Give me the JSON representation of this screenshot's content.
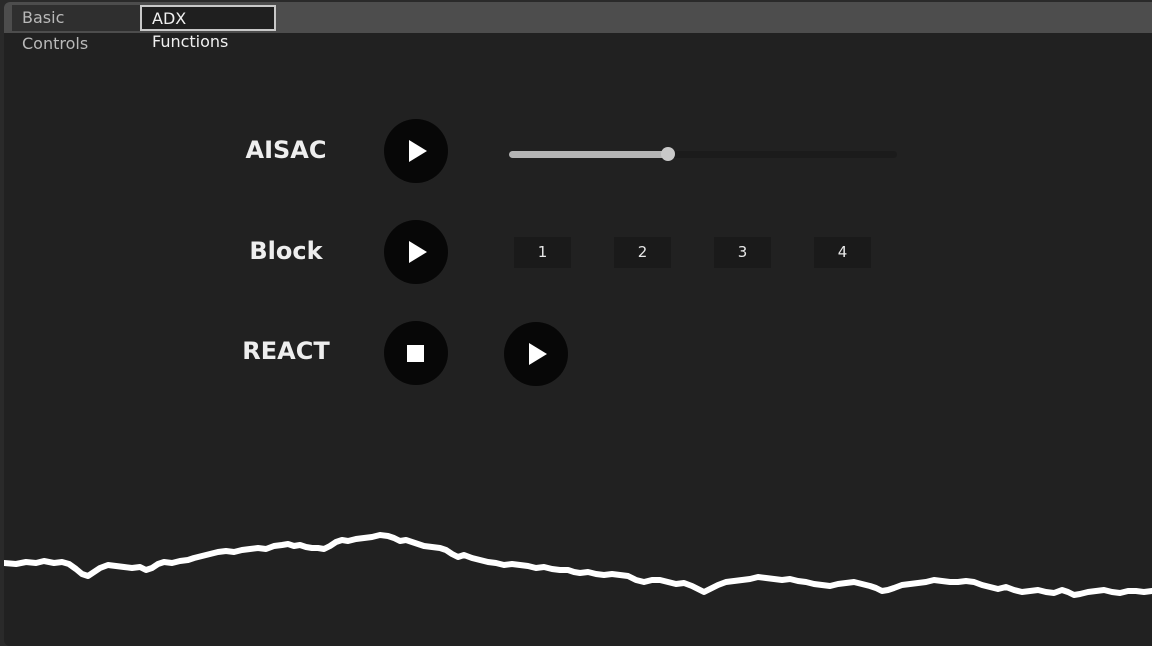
{
  "tabs": [
    {
      "label": "Basic Controls",
      "active": false
    },
    {
      "label": "ADX Functions",
      "active": true
    }
  ],
  "rows": {
    "aisac": {
      "label": "AISAC",
      "play_icon": "play-icon",
      "slider_value": 0.41
    },
    "block": {
      "label": "Block",
      "play_icon": "play-icon",
      "buttons": [
        "1",
        "2",
        "3",
        "4"
      ]
    },
    "react": {
      "label": "REACT",
      "stop_icon": "stop-icon",
      "play_icon": "play-icon"
    }
  },
  "waveform": {
    "icon": "waveform",
    "color": "#ffffff"
  },
  "colors": {
    "background": "#212121",
    "tabbar": "#4d4d4d",
    "button": "#070707",
    "slider_fill": "#b5b5b5"
  }
}
